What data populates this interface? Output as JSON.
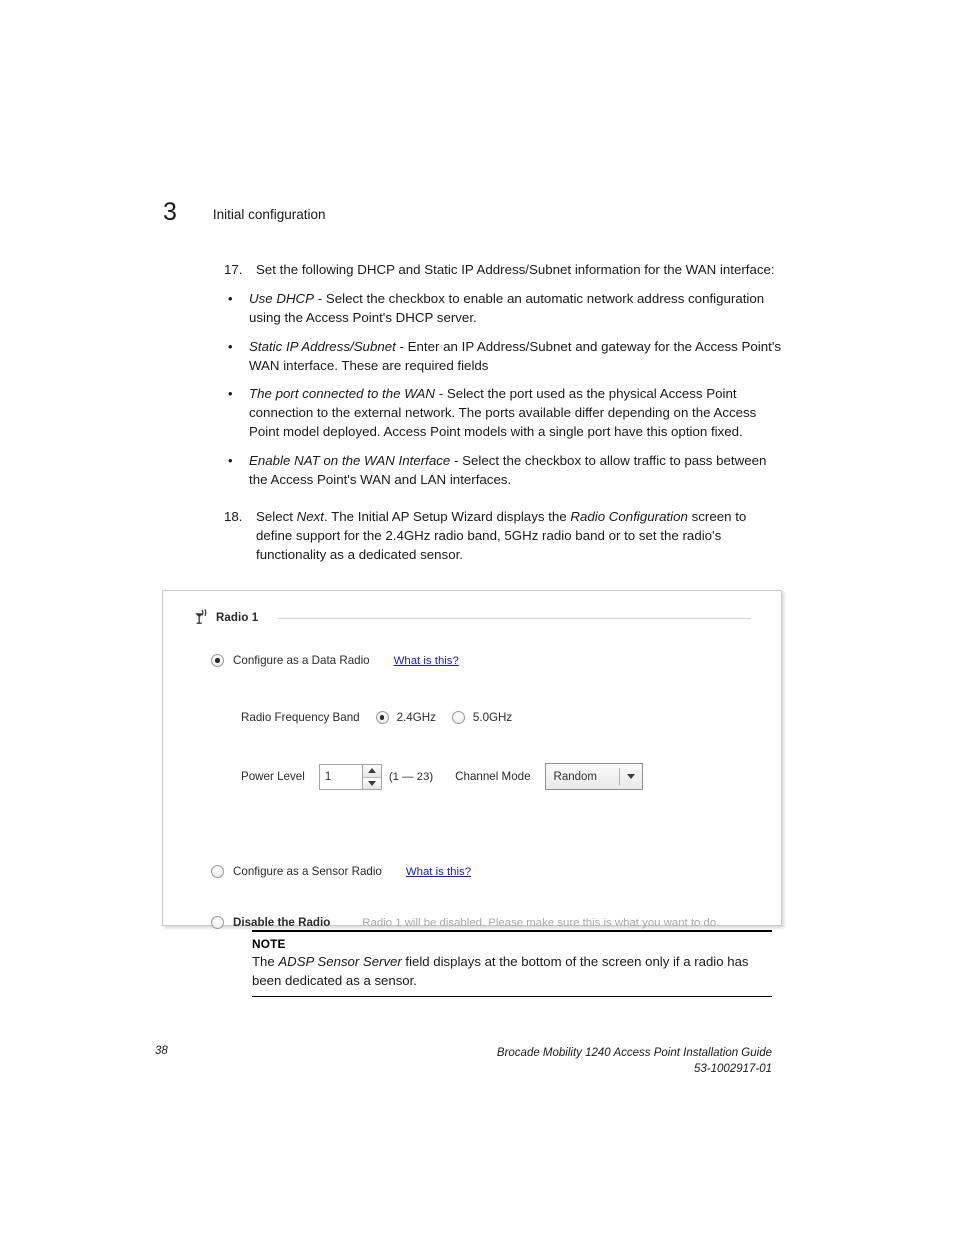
{
  "chapter": {
    "number": "3",
    "title": "Initial configuration"
  },
  "steps": [
    {
      "number": "17.",
      "text_parts": [
        {
          "style": "normal",
          "text": "Set the following DHCP and Static IP Address/Subnet information for the WAN interface:"
        }
      ],
      "full_text": "Set the following DHCP and Static IP Address/Subnet information for the WAN interface:"
    },
    {
      "number": "18.",
      "full_text": "Select Next. The Initial AP Setup Wizard displays the Radio Configuration screen to define support for the 2.4GHz radio band, 5GHz radio band or to set the radio's functionality as a dedicated sensor."
    }
  ],
  "step17": {
    "number": "17.",
    "lead": "Set the following DHCP and Static IP Address/Subnet information for the WAN interface:",
    "bullets": [
      {
        "marker": "•",
        "term": "Use DHCP",
        "rest": " - Select the checkbox to enable an automatic network address configuration using the Access Point's DHCP server."
      },
      {
        "marker": "•",
        "term": "Static IP Address/Subnet",
        "rest": " - Enter an IP Address/Subnet and gateway for the Access Point's WAN interface. These are required fields"
      },
      {
        "marker": "•",
        "term": "The port connected to the WAN",
        "rest": " - Select the port used as the physical Access Point connection to the external network. The ports available differ depending on the Access Point model deployed. Access Point models with a single port have this option fixed."
      },
      {
        "marker": "•",
        "term": "Enable NAT on the WAN Interface",
        "rest": " - Select the checkbox to allow traffic to pass between the Access Point's WAN and LAN interfaces."
      }
    ]
  },
  "step18": {
    "number": "18.",
    "seg1": "Select ",
    "em1": "Next",
    "seg2": ". The Initial AP Setup Wizard displays the ",
    "em2": "Radio Configuration",
    "seg3": " screen to define support for the 2.4GHz radio band, 5GHz radio band or to set the radio's functionality as a dedicated sensor."
  },
  "screenshot": {
    "group_title": "Radio 1",
    "group_icon": "antenna-icon",
    "options": {
      "data_radio": {
        "label": "Configure as a Data Radio",
        "selected": true,
        "help_link": "What is this?"
      },
      "sensor_radio": {
        "label": "Configure as a Sensor Radio",
        "selected": false,
        "help_link": "What is this?"
      },
      "disable_radio": {
        "label": "Disable the Radio",
        "selected": false,
        "note": "Radio 1 will be disabled. Please make sure this is what you want to do."
      }
    },
    "frequency_band": {
      "label": "Radio Frequency Band",
      "options": [
        {
          "label": "2.4GHz",
          "selected": true
        },
        {
          "label": "5.0GHz",
          "selected": false
        }
      ]
    },
    "power_level": {
      "label": "Power Level",
      "value": "1",
      "range_hint": "(1 — 23)",
      "up_icon": "triangle-up-icon",
      "down_icon": "triangle-down-icon"
    },
    "channel_mode": {
      "label": "Channel Mode",
      "value": "Random",
      "arrow_icon": "chevron-down-icon"
    },
    "colors": {
      "link": "#1919cf",
      "border": "#c9c9c9",
      "muted_text": "#a8a8a8"
    }
  },
  "note": {
    "title": "NOTE",
    "seg1": "The ",
    "em1": "ADSP Sensor Server",
    "seg2": " field displays at the bottom of the screen only if a radio has been dedicated as a sensor."
  },
  "footer": {
    "page_number": "38",
    "guide_title": "Brocade Mobility 1240 Access Point Installation Guide",
    "doc_number": "53-1002917-01"
  }
}
